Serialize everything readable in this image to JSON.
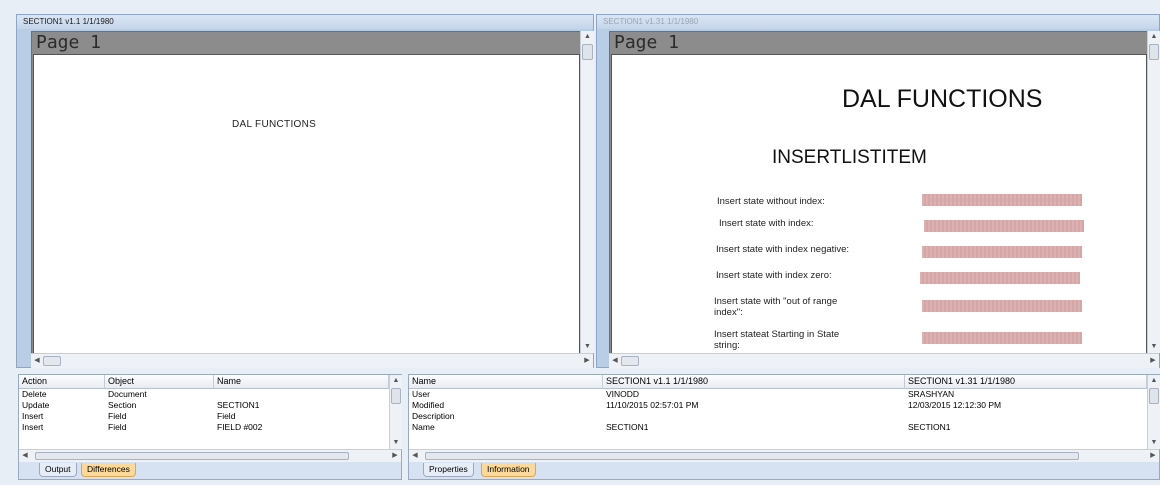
{
  "left_pane": {
    "title": "SECTION1 v1.1 1/1/1980",
    "page_label": "Page 1",
    "doc_title": "DAL FUNCTIONS"
  },
  "right_pane": {
    "title": "SECTION1 v1.31 1/1/1980",
    "page_label": "Page 1",
    "doc_title": "DAL FUNCTIONS",
    "doc_subtitle": "INSERTLISTITEM",
    "fields": [
      "Insert state without index:",
      "Insert state with index:",
      "Insert state with index negative:",
      "Insert state with index zero:",
      "Insert state with \"out of range index\":",
      "Insert stateat Starting in State string:"
    ]
  },
  "differences_grid": {
    "columns": [
      "Action",
      "Object",
      "Name"
    ],
    "rows": [
      [
        "Delete",
        "Document",
        ""
      ],
      [
        "Update",
        "Section",
        "SECTION1"
      ],
      [
        "Insert",
        "Field",
        "Field"
      ],
      [
        "Insert",
        "Field",
        "FIELD #002"
      ]
    ],
    "tabs": [
      "Output",
      "Differences"
    ],
    "active_tab": "Differences"
  },
  "properties_grid": {
    "columns": [
      "Name",
      "SECTION1 v1.1 1/1/1980",
      "SECTION1 v1.31 1/1/1980"
    ],
    "rows": [
      [
        "User",
        "VINODD",
        "SRASHYAN"
      ],
      [
        "Modified",
        "11/10/2015 02:57:01 PM",
        "12/03/2015 12:12:30 PM"
      ],
      [
        "Description",
        "",
        ""
      ],
      [
        "Name",
        "SECTION1",
        "SECTION1"
      ]
    ],
    "tabs": [
      "Properties",
      "Information"
    ],
    "active_tab": "Information"
  },
  "icons": {
    "scroll_up": "up-arrow-icon",
    "scroll_down": "down-arrow-icon",
    "scroll_left": "left-arrow-icon",
    "scroll_right": "right-arrow-icon"
  },
  "colors": {
    "frame": "#b8cde6",
    "active_tab": "#fbd99a",
    "placeholder_bar": "#dcb1b1"
  }
}
